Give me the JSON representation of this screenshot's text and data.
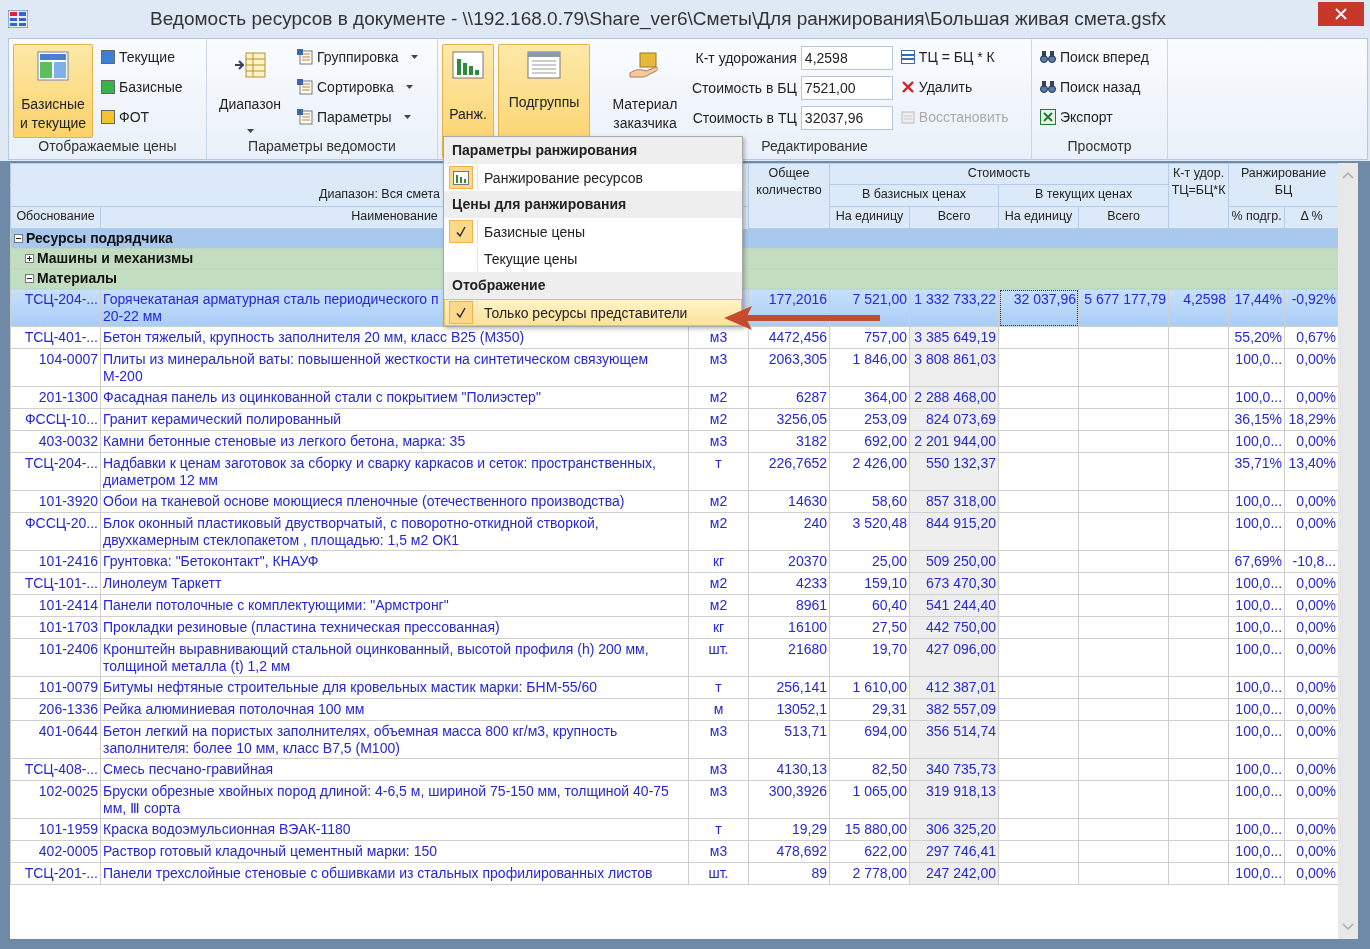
{
  "window": {
    "title": "Ведомость ресурсов в документе - \\\\192.168.0.79\\Share_ver6\\Сметы\\Для ранжирования\\Большая живая смета.gsfx"
  },
  "ribbon": {
    "prices": {
      "label": "Отображаемые цены",
      "main": {
        "label": "Базисные и текущие",
        "selected": true
      },
      "options": [
        {
          "label": "Текущие",
          "selected": false
        },
        {
          "label": "Базисные",
          "selected": false
        },
        {
          "label": "ФОТ",
          "selected": false
        }
      ]
    },
    "params": {
      "label": "Параметры ведомости",
      "range": {
        "label": "Диапазон"
      },
      "commands": [
        {
          "label": "Группировка"
        },
        {
          "label": "Сортировка"
        },
        {
          "label": "Параметры"
        }
      ]
    },
    "ranking": {
      "rank": {
        "label": "Ранж.",
        "selected": true
      },
      "subgroups": {
        "label": "Подгруппы",
        "selected": true
      }
    },
    "edit": {
      "label": "Редактирование",
      "customer": {
        "label": "Материал заказчика"
      },
      "fields": [
        {
          "label": "К-т удорожания",
          "value": "4,2598"
        },
        {
          "label": "Стоимость в БЦ",
          "value": "7521,00"
        },
        {
          "label": "Стоимость в ТЦ",
          "value": "32037,96"
        }
      ],
      "commands": [
        {
          "label": "ТЦ = БЦ * К",
          "disabled": false
        },
        {
          "label": "Удалить",
          "disabled": false
        },
        {
          "label": "Восстановить",
          "disabled": true
        }
      ]
    },
    "view": {
      "label": "Просмотр",
      "commands": [
        {
          "label": "Поиск вперед"
        },
        {
          "label": "Поиск назад"
        },
        {
          "label": "Экспорт"
        }
      ]
    }
  },
  "menu": {
    "sections": [
      {
        "title": "Параметры ранжирования",
        "items": [
          {
            "kind": "command",
            "label": "Ранжирование ресурсов",
            "highlighted": false
          }
        ]
      },
      {
        "title": "Цены для ранжирования",
        "items": [
          {
            "kind": "check",
            "label": "Базисные цены",
            "checked": true,
            "highlighted": false
          },
          {
            "kind": "check",
            "label": "Текущие цены",
            "checked": false,
            "highlighted": false
          }
        ]
      },
      {
        "title": "Отображение",
        "items": [
          {
            "kind": "check",
            "label": "Только ресурсы представители",
            "checked": true,
            "highlighted": true
          }
        ]
      }
    ]
  },
  "table": {
    "header": {
      "range": "Диапазон: Вся смета",
      "code": "Обоснование",
      "name": "Наименование",
      "qty": "Общее количество",
      "cost": "Стоимость",
      "base": "В базисных ценах",
      "current": "В текущих ценах",
      "base_unit": "На единицу",
      "base_total": "Всего",
      "cur_unit": "На единицу",
      "cur_total": "Всего",
      "coef": "К-т удор. ТЦ=БЦ*К",
      "ranking": "Ранжирование БЦ",
      "share": "% подгр.",
      "delta": "Δ %"
    },
    "tree": [
      {
        "label": "Ресурсы подрядчика",
        "expanded": true,
        "children": [
          {
            "label": "Машины и механизмы",
            "expanded": false
          },
          {
            "label": "Материалы",
            "expanded": true,
            "rows": [
              {
                "selected": true,
                "code": "ТСЦ-204-...",
                "name": "Горячекатаная арматурная сталь периодического п",
                "name_wrap": "20-22 мм",
                "qty": "177,2016",
                "base_unit": "7 521,00",
                "base_total": "1 332 733,22",
                "cur_unit": "32 037,96",
                "cur_total": "5 677 177,79",
                "coef": "4,2598",
                "share": "17,44%",
                "delta": "-0,92%"
              },
              {
                "selected": false,
                "code": "ТСЦ-401-...",
                "name": "Бетон тяжелый, крупность заполнителя 20 мм, класс B25 (М350)",
                "unit": "м3",
                "qty": "4472,456",
                "base_unit": "757,00",
                "base_total": "3 385 649,19",
                "share": "55,20%",
                "delta": "0,67%"
              },
              {
                "selected": false,
                "code": "104-0007",
                "name": "Плиты из минеральной ваты: повышенной жесткости на синтетическом связующем М-200",
                "unit": "м3",
                "qty": "2063,305",
                "base_unit": "1 846,00",
                "base_total": "3 808 861,03",
                "share": "100,0...",
                "delta": "0,00%"
              },
              {
                "selected": false,
                "code": "201-1300",
                "name": "Фасадная панель из оцинкованной стали с покрытием \"Полиэстер\"",
                "unit": "м2",
                "qty": "6287",
                "base_unit": "364,00",
                "base_total": "2 288 468,00",
                "share": "100,0...",
                "delta": "0,00%"
              },
              {
                "selected": false,
                "code": "ФССЦ-10...",
                "name": "Гранит керамический  полированный",
                "unit": "м2",
                "qty": "3256,05",
                "base_unit": "253,09",
                "base_total": "824 073,69",
                "share": "36,15%",
                "delta": "18,29%"
              },
              {
                "selected": false,
                "code": "403-0032",
                "name": "Камни бетонные стеновые из легкого бетона, марка: 35",
                "unit": "м3",
                "qty": "3182",
                "base_unit": "692,00",
                "base_total": "2 201 944,00",
                "share": "100,0...",
                "delta": "0,00%"
              },
              {
                "selected": false,
                "code": "ТСЦ-204-...",
                "name": "Надбавки к ценам заготовок за сборку и сварку каркасов и сеток: пространственных, диаметром 12 мм",
                "unit": "т",
                "qty": "226,7652",
                "base_unit": "2 426,00",
                "base_total": "550 132,37",
                "share": "35,71%",
                "delta": "13,40%"
              },
              {
                "selected": false,
                "code": "101-3920",
                "name": "Обои на тканевой основе моющиеся пленочные (отечественного производства)",
                "unit": "м2",
                "qty": "14630",
                "base_unit": "58,60",
                "base_total": "857 318,00",
                "share": "100,0...",
                "delta": "0,00%"
              },
              {
                "selected": false,
                "code": "ФССЦ-20...",
                "name": "Блок оконный пластиковый двустворчатый, с поворотно-откидной створкой, двухкамерным стеклопакетом , площадью:  1,5 м2 ОК1",
                "unit": "м2",
                "qty": "240",
                "base_unit": "3 520,48",
                "base_total": "844 915,20",
                "share": "100,0...",
                "delta": "0,00%"
              },
              {
                "selected": false,
                "code": "101-2416",
                "name": "Грунтовка: \"Бетоконтакт\", КНАУФ",
                "unit": "кг",
                "qty": "20370",
                "base_unit": "25,00",
                "base_total": "509 250,00",
                "share": "67,69%",
                "delta": "-10,8..."
              },
              {
                "selected": false,
                "code": "ТСЦ-101-...",
                "name": "Линолеум Таркетт",
                "unit": "м2",
                "qty": "4233",
                "base_unit": "159,10",
                "base_total": "673 470,30",
                "share": "100,0...",
                "delta": "0,00%"
              },
              {
                "selected": false,
                "code": "101-2414",
                "name": "Панели потолочные с комплектующими: \"Армстронг\"",
                "unit": "м2",
                "qty": "8961",
                "base_unit": "60,40",
                "base_total": "541 244,40",
                "share": "100,0...",
                "delta": "0,00%"
              },
              {
                "selected": false,
                "code": "101-1703",
                "name": "Прокладки резиновые (пластина техническая прессованная)",
                "unit": "кг",
                "qty": "16100",
                "base_unit": "27,50",
                "base_total": "442 750,00",
                "share": "100,0...",
                "delta": "0,00%"
              },
              {
                "selected": false,
                "code": "101-2406",
                "name": "Кронштейн выравнивающий стальной оцинкованный, высотой профиля (h) 200 мм, толщиной металла (t) 1,2 мм",
                "unit": "шт.",
                "qty": "21680",
                "base_unit": "19,70",
                "base_total": "427 096,00",
                "share": "100,0...",
                "delta": "0,00%"
              },
              {
                "selected": false,
                "code": "101-0079",
                "name": "Битумы нефтяные строительные для кровельных мастик марки: БНМ-55/60",
                "unit": "т",
                "qty": "256,141",
                "base_unit": "1 610,00",
                "base_total": "412 387,01",
                "share": "100,0...",
                "delta": "0,00%"
              },
              {
                "selected": false,
                "code": "206-1336",
                "name": "Рейка алюминиевая потолочная 100 мм",
                "unit": "м",
                "qty": "13052,1",
                "base_unit": "29,31",
                "base_total": "382 557,09",
                "share": "100,0...",
                "delta": "0,00%"
              },
              {
                "selected": false,
                "code": "401-0644",
                "name": "Бетон легкий на пористых заполнителях, объемная масса 800 кг/м3, крупность заполнителя: более 10 мм, класс В7,5 (М100)",
                "unit": "м3",
                "qty": "513,71",
                "base_unit": "694,00",
                "base_total": "356 514,74",
                "share": "100,0...",
                "delta": "0,00%"
              },
              {
                "selected": false,
                "code": "ТСЦ-408-...",
                "name": "Смесь песчано-гравийная",
                "unit": "м3",
                "qty": "4130,13",
                "base_unit": "82,50",
                "base_total": "340 735,73",
                "share": "100,0...",
                "delta": "0,00%"
              },
              {
                "selected": false,
                "code": "102-0025",
                "name": "Бруски обрезные хвойных пород длиной: 4-6,5 м, шириной 75-150 мм, толщиной 40-75 мм, Ⅲ сорта",
                "unit": "м3",
                "qty": "300,3926",
                "base_unit": "1 065,00",
                "base_total": "319 918,13",
                "share": "100,0...",
                "delta": "0,00%"
              },
              {
                "selected": false,
                "code": "101-1959",
                "name": "Краска водоэмульсионная ВЭАК-1180",
                "unit": "т",
                "qty": "19,29",
                "base_unit": "15 880,00",
                "base_total": "306 325,20",
                "share": "100,0...",
                "delta": "0,00%"
              },
              {
                "selected": false,
                "code": "402-0005",
                "name": "Раствор готовый кладочный цементный марки: 150",
                "unit": "м3",
                "qty": "478,692",
                "base_unit": "622,00",
                "base_total": "297 746,41",
                "share": "100,0...",
                "delta": "0,00%"
              },
              {
                "selected": false,
                "code": "ТСЦ-201-...",
                "name": "Панели трехслойные стеновые с обшивками из стальных профилированных листов",
                "unit": "шт.",
                "qty": "89",
                "base_unit": "2 778,00",
                "base_total": "247 242,00",
                "share": "100,0...",
                "delta": "0,00%"
              }
            ]
          }
        ]
      }
    ]
  }
}
